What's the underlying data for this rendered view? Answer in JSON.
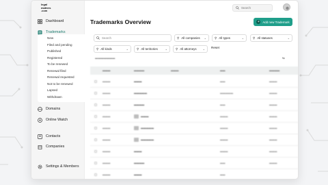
{
  "sidebar": {
    "logo": "legal matters .com",
    "items": [
      {
        "label": "Dashboard",
        "icon": "dashboard-icon"
      },
      {
        "label": "Trademarks",
        "icon": "trademark-icon"
      },
      {
        "label": "Domains",
        "icon": "domains-icon"
      },
      {
        "label": "Online Watch",
        "icon": "watch-icon"
      },
      {
        "label": "Contacts",
        "icon": "contacts-icon"
      },
      {
        "label": "Companies",
        "icon": "companies-icon"
      },
      {
        "label": "Settings & Members",
        "icon": "settings-icon"
      }
    ],
    "trademark_statuses": [
      "New",
      "Filed and pending",
      "Published",
      "Registered",
      "To be renewed",
      "Renewal filed",
      "Renewal requested",
      "Not to be renewed",
      "Lapsed",
      "Withdrawn"
    ]
  },
  "header": {
    "search_placeholder": "Search",
    "page_title": "Trademarks Overview",
    "add_button_label": "Add new Trademark"
  },
  "filters": {
    "search_placeholder": "Search",
    "companies": "All companies",
    "types": "All types",
    "statuses": "All statuses",
    "kinds": "All kinds",
    "territories": "All territories",
    "attorneys": "All attorneys",
    "reset_label": "Reset"
  },
  "colors": {
    "accent": "#1f9e8a",
    "active_nav": "#1a7a6d",
    "sidebar_bg": "#f5f5f5"
  }
}
